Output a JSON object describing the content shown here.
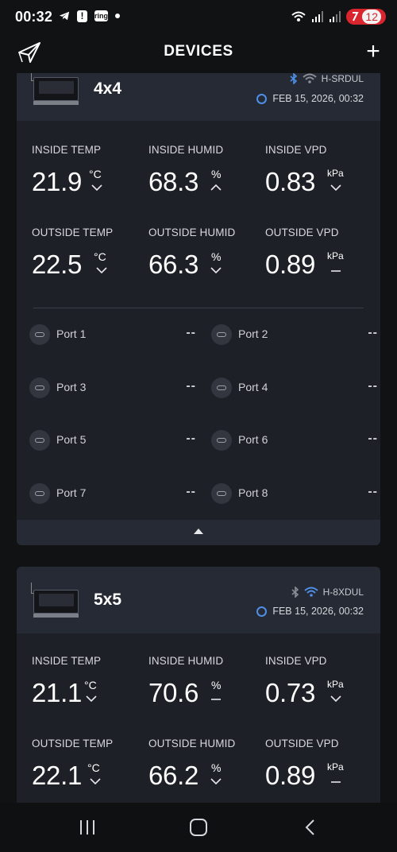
{
  "status_bar": {
    "time": "00:32",
    "ring_label": "ring",
    "battery": "12"
  },
  "header": {
    "title": "DEVICES",
    "add_label": "+"
  },
  "devices": [
    {
      "name": "4x4",
      "wifi_name": "H-SRDUL",
      "timestamp": "FEB 15, 2026, 00:32",
      "metrics": [
        {
          "label": "INSIDE TEMP",
          "value": "21.9",
          "unit": "°C",
          "trend": "down"
        },
        {
          "label": "INSIDE HUMID",
          "value": "68.3",
          "unit": "%",
          "trend": "up"
        },
        {
          "label": "INSIDE VPD",
          "value": "0.83",
          "unit": "kPa",
          "trend": "down"
        },
        {
          "label": "OUTSIDE TEMP",
          "value": "22.5",
          "unit": "°C",
          "trend": "down"
        },
        {
          "label": "OUTSIDE HUMID",
          "value": "66.3",
          "unit": "%",
          "trend": "down"
        },
        {
          "label": "OUTSIDE VPD",
          "value": "0.89",
          "unit": "kPa",
          "trend": "flat"
        }
      ],
      "ports": [
        {
          "label": "Port 1",
          "value": "--"
        },
        {
          "label": "Port 2",
          "value": "--"
        },
        {
          "label": "Port 3",
          "value": "--"
        },
        {
          "label": "Port 4",
          "value": "--"
        },
        {
          "label": "Port 5",
          "value": "--"
        },
        {
          "label": "Port 6",
          "value": "--"
        },
        {
          "label": "Port 7",
          "value": "--"
        },
        {
          "label": "Port 8",
          "value": "--"
        }
      ]
    },
    {
      "name": "5x5",
      "wifi_name": "H-8XDUL",
      "timestamp": "FEB 15, 2026, 00:32",
      "metrics": [
        {
          "label": "INSIDE TEMP",
          "value": "21.1",
          "unit": "°C",
          "trend": "down"
        },
        {
          "label": "INSIDE HUMID",
          "value": "70.6",
          "unit": "%",
          "trend": "flat"
        },
        {
          "label": "INSIDE VPD",
          "value": "0.73",
          "unit": "kPa",
          "trend": "down"
        },
        {
          "label": "OUTSIDE TEMP",
          "value": "22.1",
          "unit": "°C",
          "trend": "down"
        },
        {
          "label": "OUTSIDE HUMID",
          "value": "66.2",
          "unit": "%",
          "trend": "down"
        },
        {
          "label": "OUTSIDE VPD",
          "value": "0.89",
          "unit": "kPa",
          "trend": "flat"
        }
      ]
    }
  ],
  "icons": {
    "bluetooth_active": "#4e8fe8",
    "bluetooth_inactive": "#8a8d95",
    "wifi_active": "#4e8fe8",
    "wifi_inactive": "#8a8d95",
    "status_ring": "#4e8fe8"
  },
  "colors": {
    "background": "#111214",
    "card": "#1e2027",
    "card_header": "#262a34",
    "battery": "#d8252e"
  }
}
